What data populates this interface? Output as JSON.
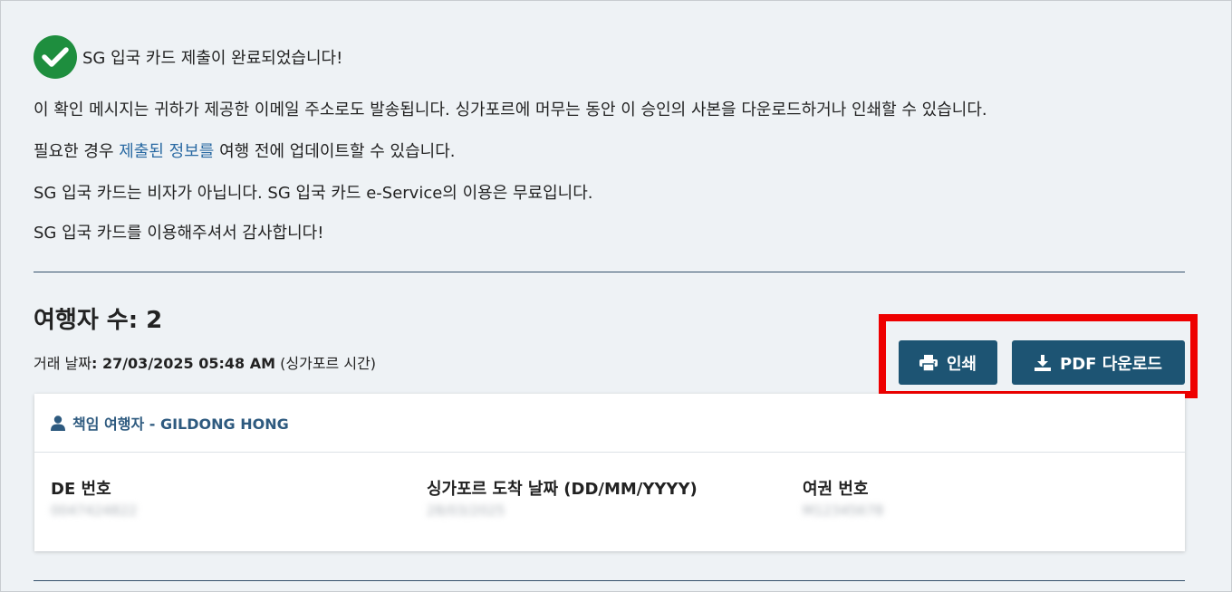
{
  "confirmation": {
    "title": "SG 입국 카드 제출이 완료되었습니다!",
    "email_notice": "이 확인 메시지는 귀하가 제공한 이메일 주소로도 발송됩니다. 싱가포르에 머무는 동안 이 승인의 사본을 다운로드하거나 인쇄할 수 있습니다.",
    "update_prefix": "필요한 경우 ",
    "update_link": "제출된 정보를",
    "update_suffix": " 여행 전에 업데이트할 수 있습니다.",
    "visa_notice": "SG 입국 카드는 비자가 아닙니다. SG 입국 카드 e-Service의 이용은 무료입니다.",
    "thanks": "SG 입국 카드를 이용해주셔서 감사합니다!"
  },
  "summary": {
    "travelers_label": "여행자 수: 2",
    "txn_label": "거래 날짜",
    "txn_value": ": 27/03/2025 05:48 AM",
    "txn_suffix": " (싱가포르 시간)"
  },
  "actions": {
    "print_label": "인쇄",
    "pdf_label": "PDF 다운로드"
  },
  "traveler_card": {
    "header": "책임 여행자 - GILDONG HONG",
    "fields": [
      {
        "label": "DE 번호",
        "value": "0047424822"
      },
      {
        "label": "싱가포르 도착 날짜 (DD/MM/YYYY)",
        "value": "28/03/2025"
      },
      {
        "label": "여권 번호",
        "value": "M12345678"
      }
    ]
  },
  "colors": {
    "accent": "#1d5473",
    "success": "#1e8e3e",
    "link": "#2a6aa3",
    "highlight": "#ee0000"
  }
}
